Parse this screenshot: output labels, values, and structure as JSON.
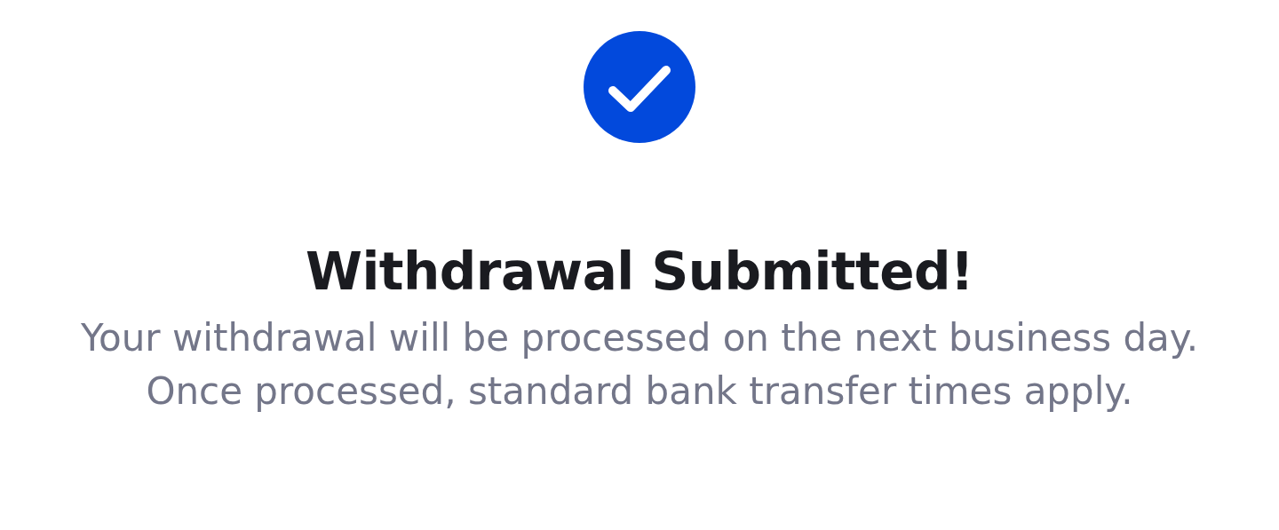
{
  "title": "Withdrawal Submitted!",
  "message": "Your withdrawal will be processed on the next business day. Once processed, standard bank transfer times apply."
}
